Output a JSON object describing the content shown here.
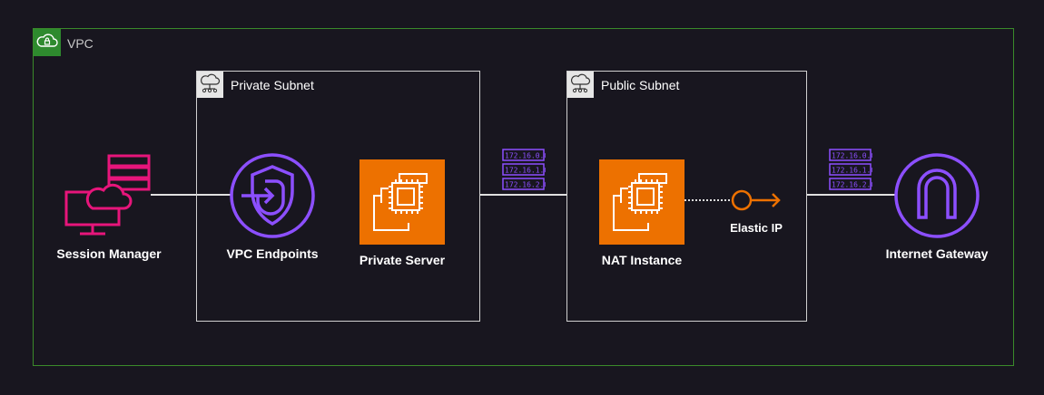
{
  "vpc": {
    "label": "VPC"
  },
  "private_subnet": {
    "label": "Private Subnet"
  },
  "public_subnet": {
    "label": "Public Subnet"
  },
  "nodes": {
    "session_manager": "Session Manager",
    "vpc_endpoints": "VPC Endpoints",
    "private_server": "Private Server",
    "nat_instance": "NAT Instance",
    "elastic_ip": "Elastic IP",
    "internet_gateway": "Internet Gateway"
  },
  "route_tables": {
    "left": [
      "172.16.0.0",
      "172.16.1.0",
      "172.16.2.0"
    ],
    "right": [
      "172.16.0.0",
      "172.16.1.0",
      "172.16.2.0"
    ]
  },
  "colors": {
    "vpc_border": "#3a8a2a",
    "session_manager": "#e7157b",
    "endpoint_purple": "#8c4fff",
    "ec2_orange": "#ed7100",
    "connector": "#e0e0e0"
  },
  "icons": {
    "vpc": "vpc-cloud-lock-icon",
    "subnet": "subnet-cloud-icon",
    "session_manager": "session-manager-icon",
    "vpc_endpoints": "vpc-endpoints-icon",
    "ec2": "ec2-chip-icon",
    "elastic_ip": "elastic-ip-icon",
    "internet_gateway": "internet-gateway-icon",
    "route_table": "route-table-icon"
  }
}
